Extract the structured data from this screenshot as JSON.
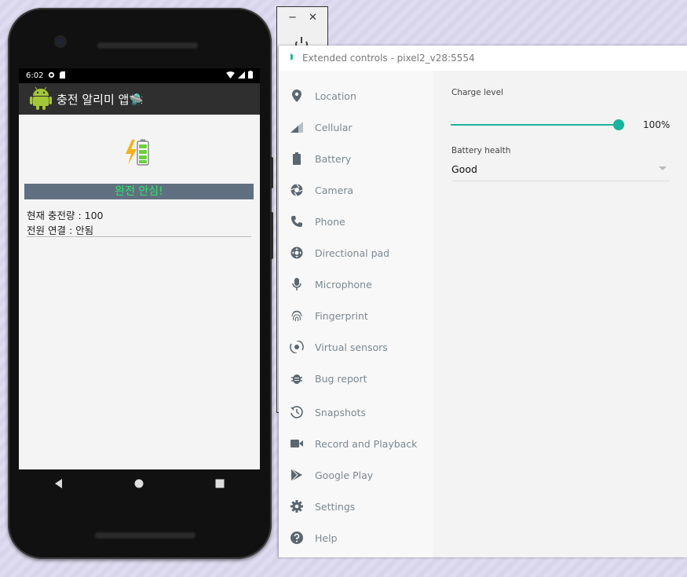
{
  "phone": {
    "status": {
      "time": "6:02"
    },
    "app_title": "충전 알리미 앱🛸",
    "banner": "완전 안심!",
    "charge_line": "현재 충전량 : 100",
    "power_line": "전원 연결 : 안됨"
  },
  "mini_window": {
    "minimize": "−",
    "close": "✕"
  },
  "extended": {
    "title": "Extended controls - pixel2_v28:5554",
    "sidebar": [
      {
        "label": "Location",
        "icon": "location-icon"
      },
      {
        "label": "Cellular",
        "icon": "cellular-icon"
      },
      {
        "label": "Battery",
        "icon": "battery-icon"
      },
      {
        "label": "Camera",
        "icon": "camera-icon"
      },
      {
        "label": "Phone",
        "icon": "phone-icon"
      },
      {
        "label": "Directional pad",
        "icon": "dpad-icon"
      },
      {
        "label": "Microphone",
        "icon": "microphone-icon"
      },
      {
        "label": "Fingerprint",
        "icon": "fingerprint-icon"
      },
      {
        "label": "Virtual sensors",
        "icon": "sensors-icon"
      },
      {
        "label": "Bug report",
        "icon": "bug-icon"
      },
      {
        "label": "Snapshots",
        "icon": "snapshots-icon"
      },
      {
        "label": "Record and Playback",
        "icon": "record-icon"
      },
      {
        "label": "Google Play",
        "icon": "play-icon"
      },
      {
        "label": "Settings",
        "icon": "settings-icon"
      },
      {
        "label": "Help",
        "icon": "help-icon"
      }
    ],
    "panel": {
      "charge_label": "Charge level",
      "charge_value_text": "100%",
      "charge_value": 100,
      "health_label": "Battery health",
      "health_value": "Good"
    }
  },
  "colors": {
    "accent": "#17b39c",
    "banner_text": "#2ee66a",
    "banner_bg": "#607080"
  }
}
